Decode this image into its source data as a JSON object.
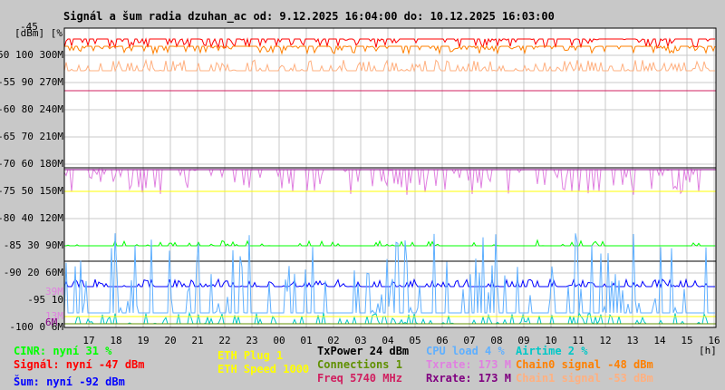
{
  "title": "Signál a šum radia dzuhan_ac od: 9.12.2025 16:04:00 do: 10.12.2025 16:03:00",
  "chart_data": {
    "type": "line",
    "title": "Signál a šum radia dzuhan_ac od: 9.12.2025 16:04:00 do: 10.12.2025 16:03:00",
    "ylabel": "[dBm] [%]",
    "ylim": [
      -100,
      -45
    ],
    "y_ticks_dbm": [
      "-45",
      "-50",
      "-55",
      "-60",
      "-65",
      "-70",
      "-75",
      "-80",
      "-85",
      "-90",
      "-95",
      "-100"
    ],
    "y_ticks_pct": [
      "",
      "100",
      "90",
      "80",
      "70",
      "60",
      "50",
      "40",
      "30",
      "20",
      "10",
      "0"
    ],
    "y_ticks_rate": [
      "",
      "300M",
      "270M",
      "240M",
      "210M",
      "180M",
      "150M",
      "120M",
      "90M",
      "60M",
      "",
      "6M"
    ],
    "right_axis_labels": [
      "39M",
      "13M",
      "6M"
    ],
    "x_ticks": [
      "17",
      "18",
      "19",
      "20",
      "21",
      "22",
      "23",
      "00",
      "01",
      "02",
      "03",
      "04",
      "05",
      "06",
      "07",
      "08",
      "09",
      "10",
      "11",
      "12",
      "13",
      "14",
      "15",
      "16"
    ],
    "xunit": "[h]",
    "grid": true,
    "series": [
      {
        "name": "Signál",
        "color": "#ff0000",
        "level_dbm": -47
      },
      {
        "name": "Chain0 signal",
        "color": "#ff8000",
        "level_dbm": -48
      },
      {
        "name": "Chain1 signal",
        "color": "#ffb080",
        "level_dbm": -53
      },
      {
        "name": "Freq",
        "color": "#d02060",
        "level_dbm": -56.5
      },
      {
        "name": "Rxrate",
        "color": "#800080",
        "level_dbm": -71.5
      },
      {
        "name": "Txrate",
        "color": "#e080e0",
        "level_dbm": -74
      },
      {
        "name": "ETH Speed",
        "color": "#ffff00",
        "level_dbm": -75.7
      },
      {
        "name": "CINR",
        "color": "#00ff00",
        "level_pct": 31
      },
      {
        "name": "TxPower",
        "color": "#000000",
        "level_dbm": -88.5
      },
      {
        "name": "Šum",
        "color": "#0000ff",
        "level_dbm": -92
      },
      {
        "name": "CPU load",
        "color": "#60b0ff",
        "level_pct": 4
      },
      {
        "name": "Airtime",
        "color": "#00c8c8",
        "level_pct": 2
      },
      {
        "name": "ETH Plug",
        "color": "#ffff00",
        "level_pct": 2
      },
      {
        "name": "Connections",
        "color": "#609000",
        "level_pct": 1
      }
    ]
  },
  "legend": {
    "cinr": "CINR: nyní 31 %",
    "signal": "Signál: nyní -47 dBm",
    "noise": "Šum: nyní -92 dBm",
    "eth_plug": "ETH Plug 1",
    "eth_speed": "ETH Speed 1000",
    "txpower": "TxPower 24 dBm",
    "connections": "Connections 1",
    "freq": "Freq 5740 MHz",
    "cpu": "CPU load 4 %",
    "txrate": "Txrate: 173 M",
    "rxrate": "Rxrate: 173 M",
    "airtime": "Airtime 2 %",
    "chain0": "Chain0 signal -48 dBm",
    "chain1": "Chain1 signal -53 dBm"
  }
}
